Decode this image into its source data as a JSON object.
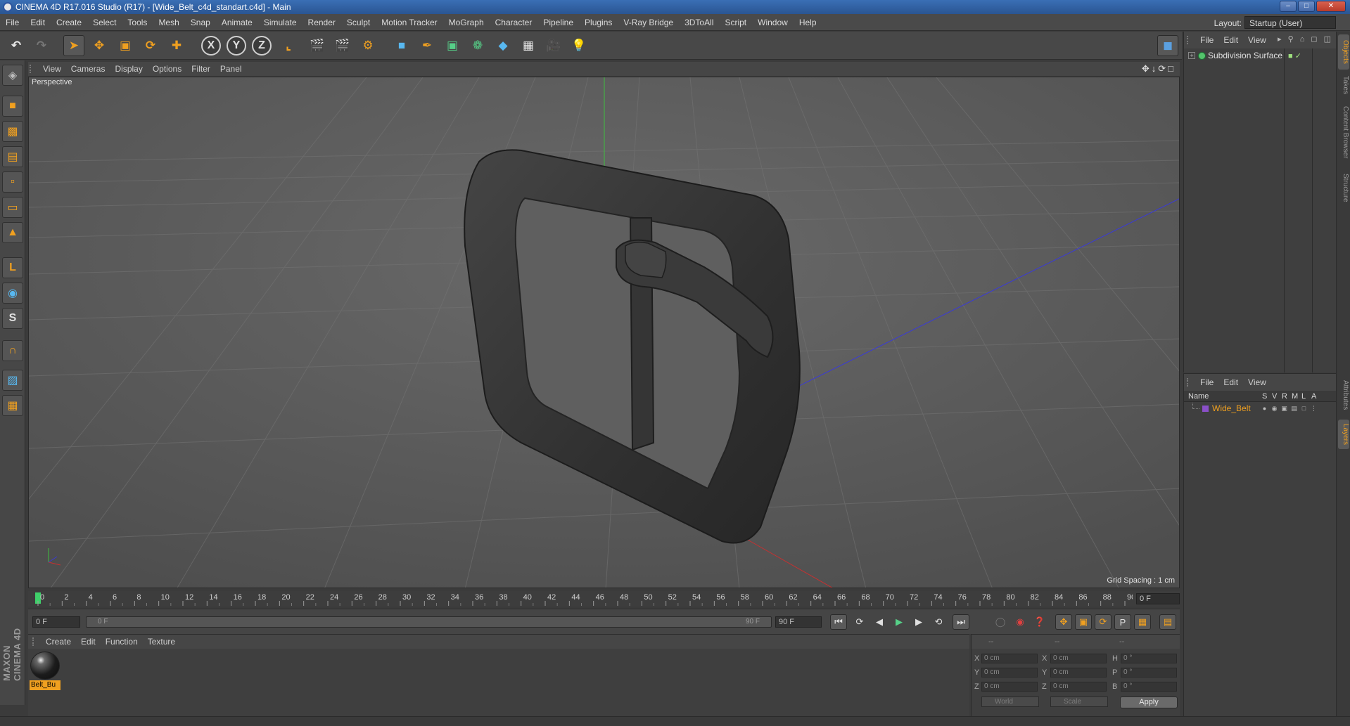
{
  "window": {
    "title": "CINEMA 4D R17.016 Studio (R17) - [Wide_Belt_c4d_standart.c4d] - Main",
    "buttons": [
      "–",
      "□",
      "✕"
    ]
  },
  "menubar": {
    "items": [
      "File",
      "Edit",
      "Create",
      "Select",
      "Tools",
      "Mesh",
      "Snap",
      "Animate",
      "Simulate",
      "Render",
      "Sculpt",
      "Motion Tracker",
      "MoGraph",
      "Character",
      "Pipeline",
      "Plugins",
      "V-Ray Bridge",
      "3DToAll",
      "Script",
      "Window",
      "Help"
    ],
    "layout_label": "Layout:",
    "layout_value": "Startup (User)"
  },
  "toolbar": {
    "axis_x": "X",
    "axis_y": "Y",
    "axis_z": "Z"
  },
  "viewport": {
    "menu": [
      "View",
      "Cameras",
      "Display",
      "Options",
      "Filter",
      "Panel"
    ],
    "camera_label": "Perspective",
    "grid_spacing": "Grid Spacing : 1 cm",
    "nav_icons": "✥↓⟳□"
  },
  "timeline": {
    "ticks": [
      "0",
      "2",
      "4",
      "6",
      "8",
      "10",
      "12",
      "14",
      "16",
      "18",
      "20",
      "22",
      "24",
      "26",
      "28",
      "30",
      "32",
      "34",
      "36",
      "38",
      "40",
      "42",
      "44",
      "46",
      "48",
      "50",
      "52",
      "54",
      "56",
      "58",
      "60",
      "62",
      "64",
      "66",
      "68",
      "70",
      "72",
      "74",
      "76",
      "78",
      "80",
      "82",
      "84",
      "86",
      "88",
      "90"
    ],
    "current_frame": "0 F",
    "range_start_field": "0 F",
    "slider_start": "0 F",
    "slider_end": "90 F",
    "range_end_field": "90 F"
  },
  "material_manager": {
    "menu": [
      "Create",
      "Edit",
      "Function",
      "Texture"
    ],
    "material_name": "Belt_Bu"
  },
  "coordinates": {
    "header": [
      "--",
      "--",
      "--"
    ],
    "rows": [
      {
        "a": "X",
        "av": "0 cm",
        "b": "X",
        "bv": "0 cm",
        "c": "H",
        "cv": "0 °"
      },
      {
        "a": "Y",
        "av": "0 cm",
        "b": "Y",
        "bv": "0 cm",
        "c": "P",
        "cv": "0 °"
      },
      {
        "a": "Z",
        "av": "0 cm",
        "b": "Z",
        "bv": "0 cm",
        "c": "B",
        "cv": "0 °"
      }
    ],
    "mode1": "World",
    "mode2": "Scale",
    "apply": "Apply"
  },
  "object_manager": {
    "menu": [
      "File",
      "Edit",
      "View"
    ],
    "object_name": "Subdivision Surface"
  },
  "layer_manager": {
    "menu": [
      "File",
      "Edit",
      "View"
    ],
    "columns": {
      "name": "Name",
      "s": "S",
      "v": "V",
      "r": "R",
      "m": "M",
      "l": "L",
      "a": "A"
    },
    "layer_name": "Wide_Belt"
  },
  "side_tabs": [
    "Objects",
    "Takes",
    "Content Browser",
    "Structure",
    "Attributes",
    "Layers"
  ],
  "logo": "MAXON CINEMA 4D",
  "colors": {
    "accent": "#f0a020",
    "title_bar": "#2a5592",
    "layer_color": "#8a50c8"
  }
}
